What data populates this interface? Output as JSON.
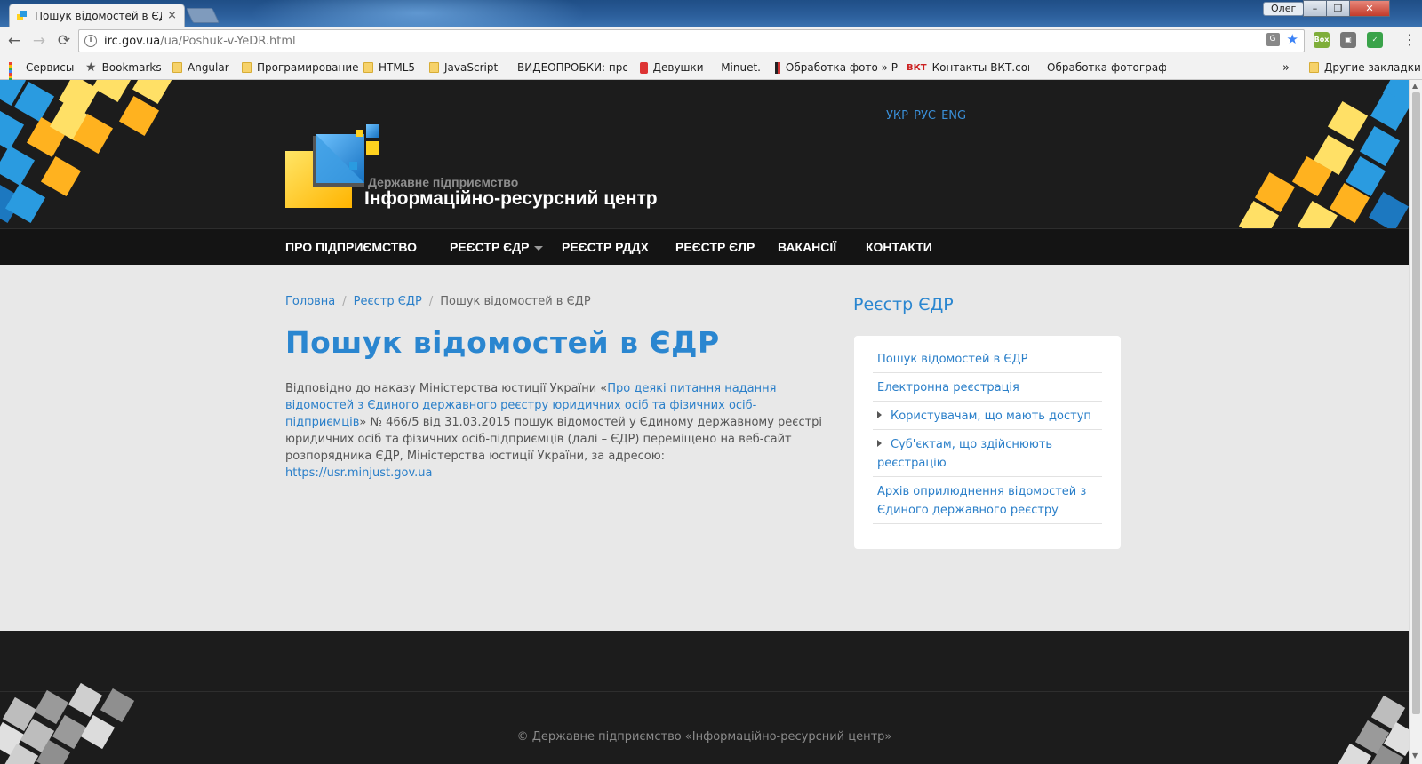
{
  "browser": {
    "tab_title": "Пошук відомостей в ЄД",
    "tab_close": "×",
    "user_name": "Олег",
    "window_buttons": [
      "–",
      "❐",
      "✕"
    ],
    "url_domain": "irc.gov.ua",
    "url_path": "/ua/Poshuk-v-YeDR.html",
    "nav_back": "←",
    "nav_forward": "→",
    "nav_reload": "⟳",
    "menu_dots": "⋮",
    "bookmarks": [
      {
        "label": "Сервисы",
        "icon": "apps-icon"
      },
      {
        "label": "Bookmarks",
        "icon": "star-icon"
      },
      {
        "label": "Angular",
        "icon": "folder-icon"
      },
      {
        "label": "Програмирование",
        "icon": "folder-icon"
      },
      {
        "label": "HTML5",
        "icon": "folder-icon"
      },
      {
        "label": "JavaScript",
        "icon": "folder-icon"
      },
      {
        "label": "ВИДЕОПРОБКИ: про",
        "icon": "page-icon"
      },
      {
        "label": "Девушки — Minuet.",
        "icon": "girl-site-icon"
      },
      {
        "label": "Обработка фото » Р",
        "icon": "photo-icon"
      },
      {
        "label": "Контакты ВКТ.com.u",
        "icon": "vkt-icon"
      },
      {
        "label": "Обработка фотограф",
        "icon": "photo2-icon"
      }
    ],
    "bookmarks_overflow": "»",
    "other_bookmarks": "Другие закладки"
  },
  "site": {
    "lang_switch": "УКР РУС ENG",
    "logo_subtitle": "Державне підприємство",
    "logo_title": "Інформаційно-ресурсний центр",
    "nav": [
      "ПРО ПІДПРИЄМСТВО",
      "РЕЄСТР ЄДР",
      "РЕЄСТР РДДХ",
      "РЕЄСТР ЄЛР",
      "ВАКАНСІЇ",
      "КОНТАКТИ"
    ],
    "breadcrumb": {
      "home": "Головна",
      "section": "Реєстр ЄДР",
      "current": "Пошук відомостей в ЄДР",
      "sep": "/"
    },
    "page_title": "Пошук відомостей в ЄДР",
    "article": {
      "p1": "Відповідно до наказу Міністерства юстиції України «",
      "link_text": "Про деякі питання надання відомостей з Єдиного державного реєстру юридичних осіб та фізичних осіб-підприємців",
      "p2": "» № 466/5 від 31.03.2015 пошук відомостей у Єдиному державному реєстрі юридичних осіб та фізичних осіб-підприємців (далі – ЄДР) переміщено на веб-сайт розпорядника ЄДР, Міністерства юстиції України, за адресою:",
      "url": "https://usr.minjust.gov.ua"
    },
    "sidebar": {
      "title": "Реєстр ЄДР",
      "items": [
        {
          "label": "Пошук відомостей в ЄДР"
        },
        {
          "label": "Електронна реєстрація"
        },
        {
          "label": "Користувачам, що мають доступ"
        },
        {
          "label": "Суб'єктам, що здійснюють реєстрацію"
        },
        {
          "label": "Архів оприлюднення відомостей з Єдиного державного реєстру"
        }
      ]
    },
    "footer": "© Державне підприємство «Інформаційно-ресурсний центр»"
  },
  "colors": {
    "accent": "#2a86d0",
    "header_bg": "#1c1c1c",
    "content_bg": "#e8e8e8",
    "tile_yellow": "#ffd21f",
    "tile_blue": "#2a9be0"
  }
}
